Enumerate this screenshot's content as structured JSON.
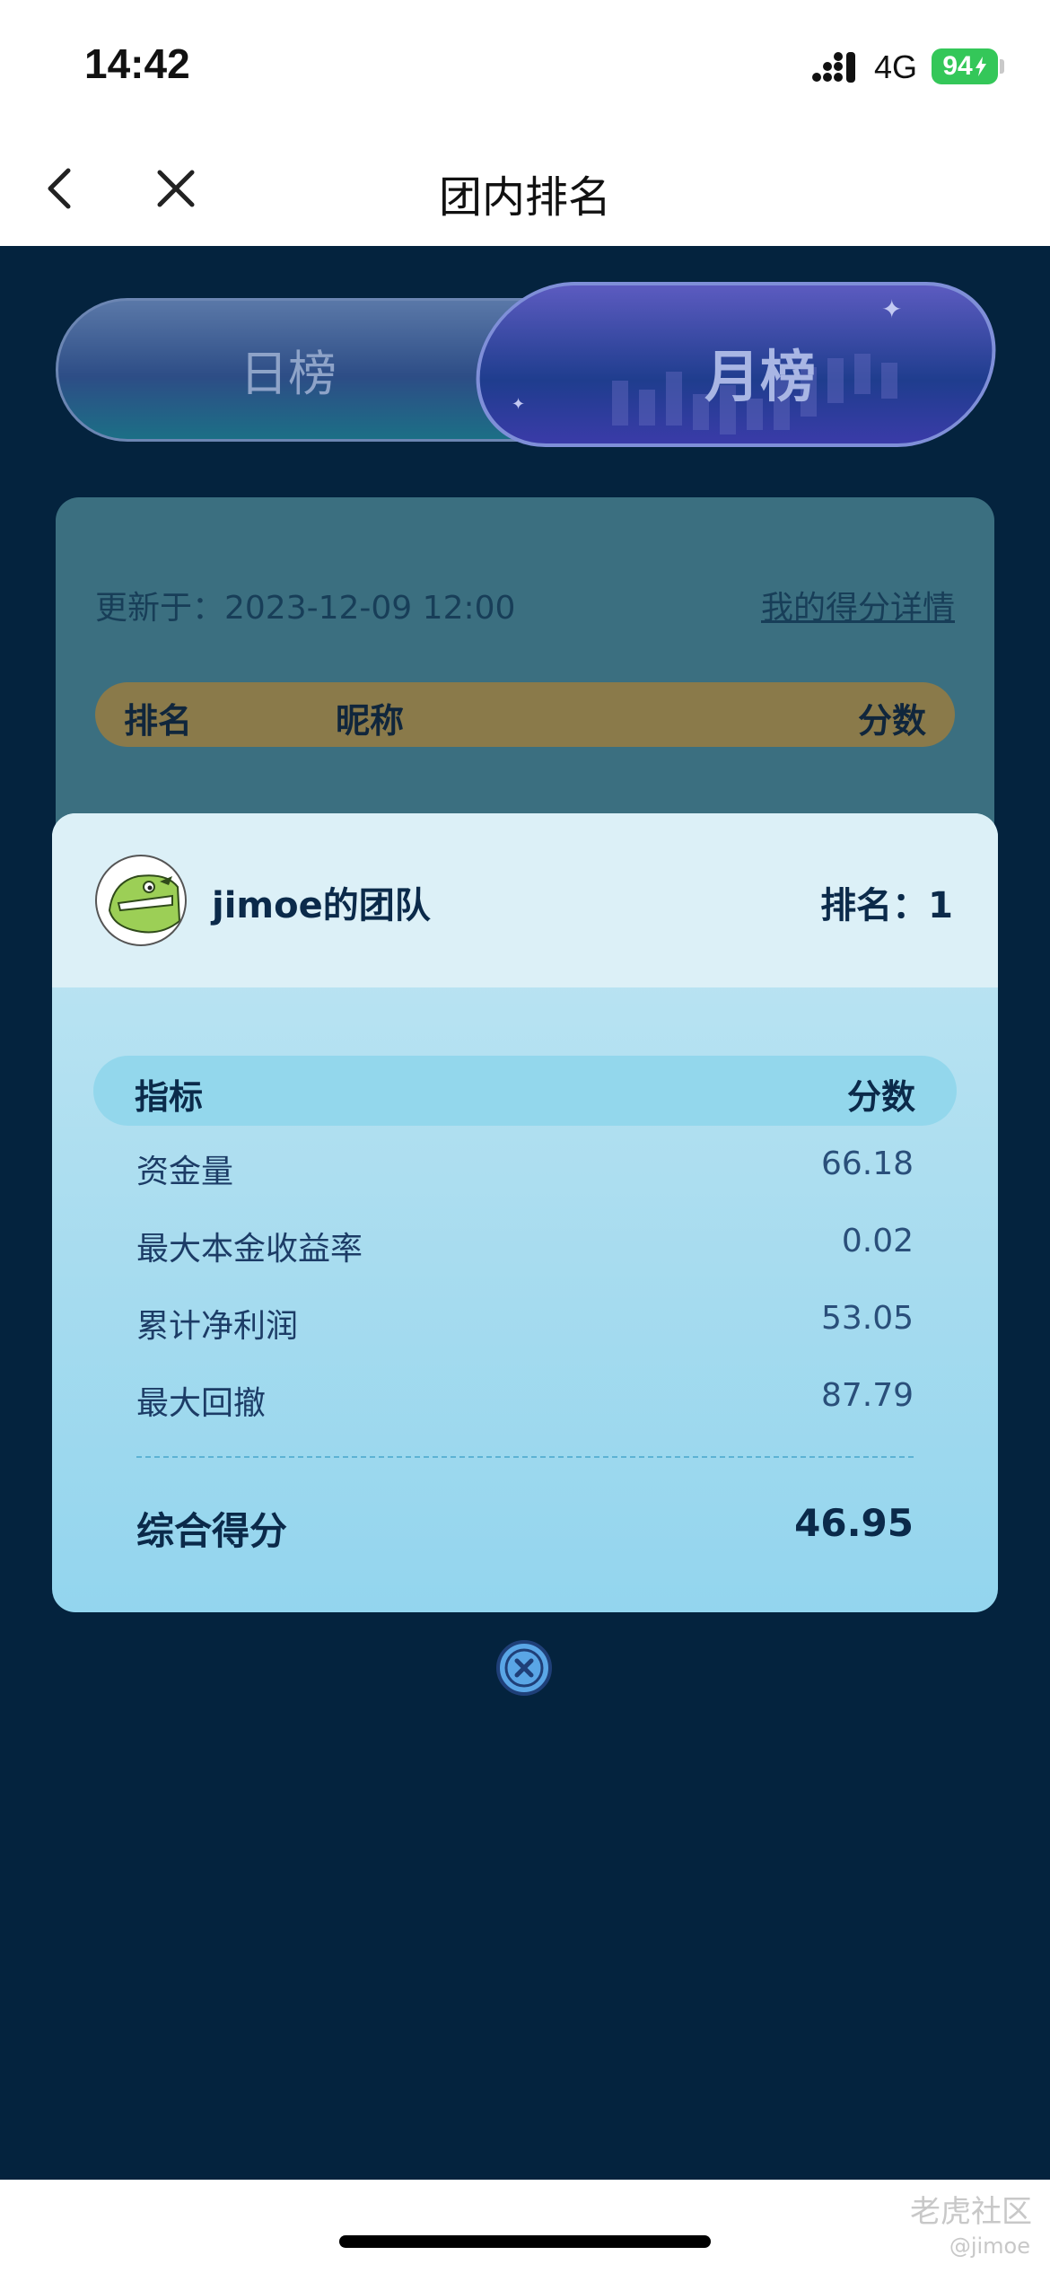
{
  "status_bar": {
    "time": "14:42",
    "network": "4G",
    "battery": "94"
  },
  "nav": {
    "title": "团内排名"
  },
  "tabs": {
    "daily": "日榜",
    "monthly": "月榜",
    "selected": "monthly"
  },
  "ranking": {
    "update_text": "更新于：2023-12-09 12:00",
    "detail_link": "我的得分详情",
    "columns": [
      "排名",
      "昵称",
      "分数"
    ]
  },
  "modal": {
    "team_name": "jimoe的团队",
    "rank_text": "排名：1",
    "header_metric": "指标",
    "header_score": "分数",
    "metrics": [
      {
        "name": "资金量",
        "value": "66.18"
      },
      {
        "name": "最大本金收益率",
        "value": "0.02"
      },
      {
        "name": "累计净利润",
        "value": "53.05"
      },
      {
        "name": "最大回撤",
        "value": "87.79"
      }
    ],
    "total_label": "综合得分",
    "total_value": "46.95"
  },
  "watermark": {
    "brand": "老虎社区",
    "handle": "@jimoe"
  },
  "colors": {
    "background": "#04233e",
    "modal_head": "#dcf0f7",
    "header_gold": "#8a7a4a",
    "battery": "#34c759"
  }
}
